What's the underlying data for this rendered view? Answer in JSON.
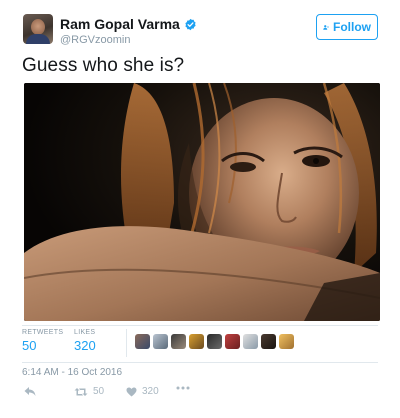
{
  "tweet": {
    "author": {
      "display_name": "Ram Gopal Varma",
      "handle": "@RGVzoomin",
      "verified": true
    },
    "follow_label": "Follow",
    "text": "Guess who she is?",
    "stats": {
      "retweets_label": "RETWEETS",
      "retweets_value": "50",
      "likes_label": "LIKES",
      "likes_value": "320"
    },
    "likers_count_shown": 9,
    "timestamp": "6:14 AM - 16 Oct 2016",
    "actions": {
      "reply_icon": "reply-icon",
      "retweet_count": "50",
      "like_count": "320",
      "more_icon": "more-icon"
    }
  },
  "colors": {
    "accent": "#1da1f2",
    "muted": "#8899a6",
    "text": "#14171a",
    "divider": "#e1e8ed"
  }
}
